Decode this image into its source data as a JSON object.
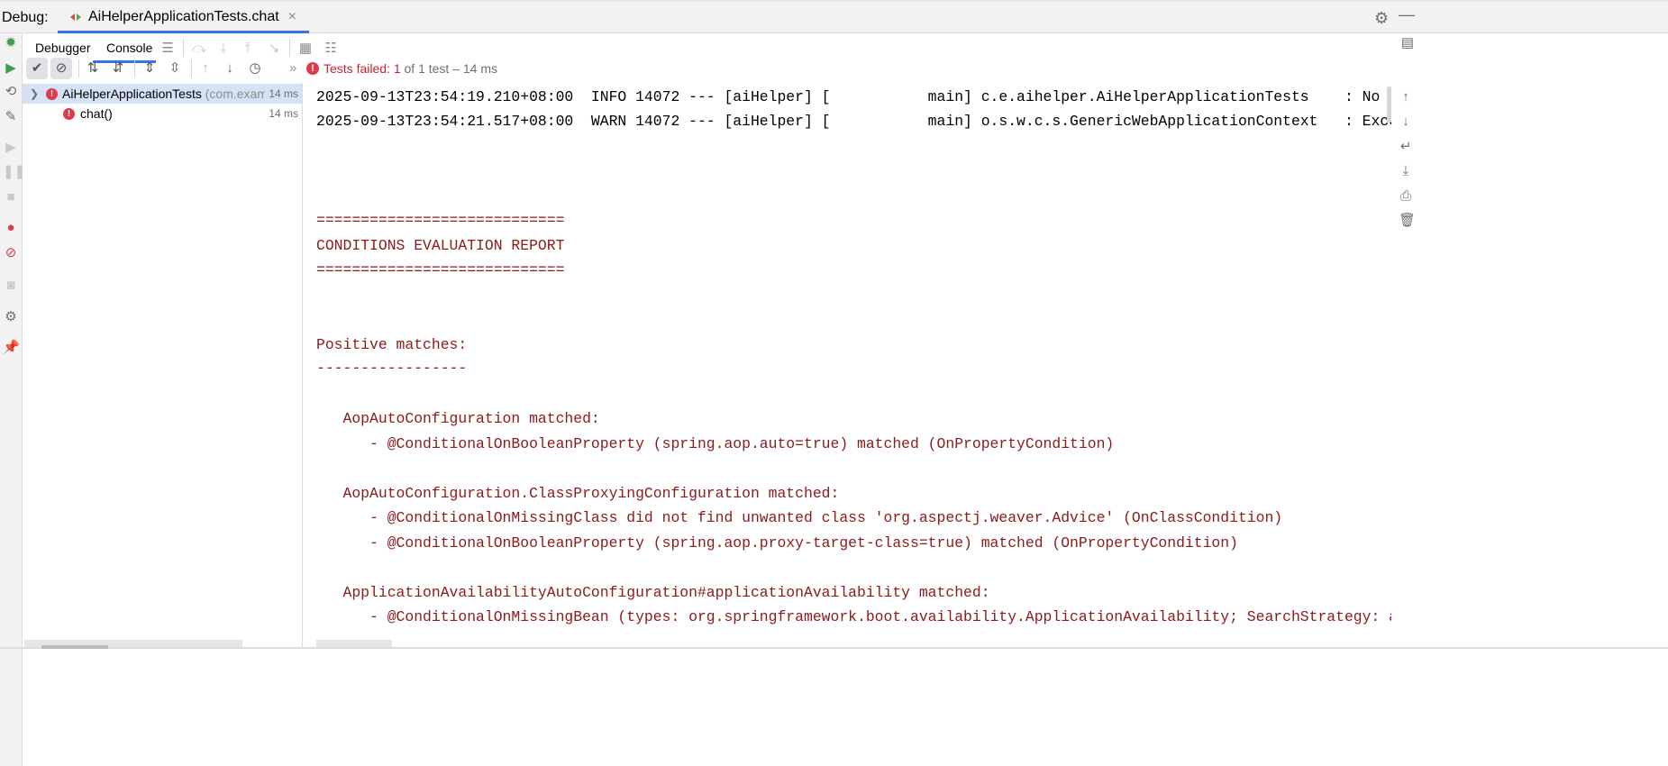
{
  "titlebar": {
    "debug_label": "Debug:",
    "tab_label": "AiHelperApplicationTests.chat",
    "close_glyph": "×"
  },
  "subtabs": {
    "debugger": "Debugger",
    "console": "Console"
  },
  "test_status": {
    "failed_text": "Tests failed: ",
    "failed_count": "1",
    "rest": " of 1 test – 14 ms"
  },
  "tree": {
    "root": {
      "name": "AiHelperApplicationTests",
      "pkg": " (com.exam",
      "time": "14 ms"
    },
    "child": {
      "name": "chat()",
      "time": "14 ms"
    }
  },
  "console": {
    "lines": [
      {
        "text": "2025-09-13T23:54:19.210+08:00  INFO 14072 --- [aiHelper] [           main] c.e.aihelper.AiHelperApplicationTests    : No active",
        "style": "black"
      },
      {
        "text": "2025-09-13T23:54:21.517+08:00  WARN 14072 --- [aiHelper] [           main] o.s.w.c.s.GenericWebApplicationContext   : Exception",
        "style": "black"
      },
      {
        "text": "============================",
        "style": "red"
      },
      {
        "text": "CONDITIONS EVALUATION REPORT",
        "style": "red"
      },
      {
        "text": "============================",
        "style": "red"
      },
      {
        "text": "Positive matches:",
        "style": "red"
      },
      {
        "text": "-----------------",
        "style": "red"
      },
      {
        "text": "   AopAutoConfiguration matched:",
        "style": "red"
      },
      {
        "text": "      - @ConditionalOnBooleanProperty (spring.aop.auto=true) matched (OnPropertyCondition)",
        "style": "red"
      },
      {
        "text": "   AopAutoConfiguration.ClassProxyingConfiguration matched:",
        "style": "red"
      },
      {
        "text": "      - @ConditionalOnMissingClass did not find unwanted class 'org.aspectj.weaver.Advice' (OnClassCondition)",
        "style": "red"
      },
      {
        "text": "      - @ConditionalOnBooleanProperty (spring.aop.proxy-target-class=true) matched (OnPropertyCondition)",
        "style": "red"
      },
      {
        "text": "   ApplicationAvailabilityAutoConfiguration#applicationAvailability matched:",
        "style": "red"
      },
      {
        "text": "      - @ConditionalOnMissingBean (types: org.springframework.boot.availability.ApplicationAvailability; SearchStrategy: all) di",
        "style": "red"
      }
    ]
  },
  "icons": {
    "gear": "gear-icon",
    "minimize": "minimize-icon"
  },
  "colors": {
    "accent": "#3574f0",
    "fail": "#db3b4b",
    "console_red": "#8b1a1a"
  }
}
